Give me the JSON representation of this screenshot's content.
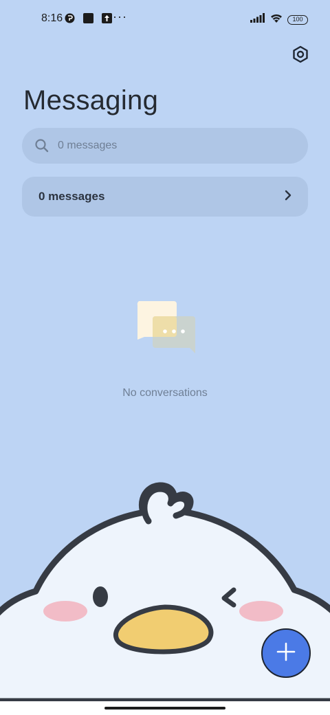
{
  "status_bar": {
    "time": "8:16",
    "left_icons": [
      "notification-app-icon",
      "square-app-icon",
      "upload-icon"
    ],
    "overflow": "···",
    "battery": "100",
    "right_icons": [
      "signal-icon",
      "wifi-icon",
      "battery-icon"
    ]
  },
  "header": {
    "title": "Messaging",
    "settings_icon": "settings-hex-icon"
  },
  "search": {
    "placeholder": "0 messages",
    "icon": "search-icon"
  },
  "folder": {
    "label": "0 messages",
    "icon": "chevron-right-icon"
  },
  "empty_state": {
    "text": "No conversations",
    "icon": "chat-bubbles-icon"
  },
  "fab": {
    "icon": "plus-icon",
    "color": "#4b7ae6"
  },
  "colors": {
    "background": "#bdd4f4",
    "surface": "#afc6e6",
    "accent": "#4b7ae6"
  }
}
